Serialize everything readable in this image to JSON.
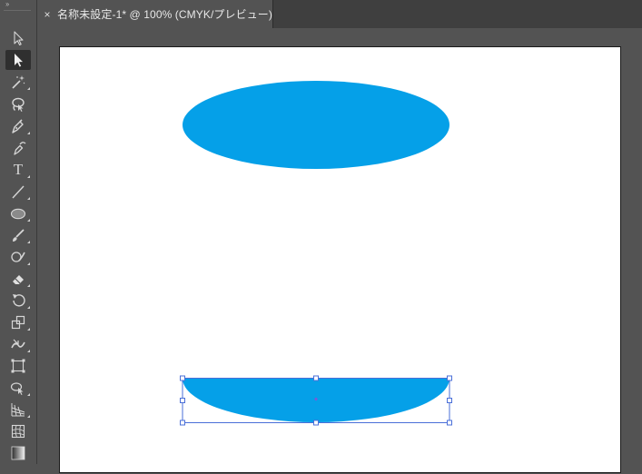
{
  "tab": {
    "close_glyph": "×",
    "title": "名称未設定-1* @ 100% (CMYK/プレビュー)"
  },
  "toolbar": {
    "grip_glyph": "››",
    "tools": [
      {
        "name": "selection-tool",
        "icon": "arrow-outline-icon",
        "active": false
      },
      {
        "name": "direct-selection-tool",
        "icon": "arrow-solid-icon",
        "active": true
      },
      {
        "name": "magic-wand-tool",
        "icon": "magic-wand-icon",
        "active": false
      },
      {
        "name": "lasso-tool",
        "icon": "lasso-icon",
        "active": false
      },
      {
        "name": "pen-tool",
        "icon": "pen-icon",
        "active": false
      },
      {
        "name": "curvature-tool",
        "icon": "curvature-pen-icon",
        "active": false
      },
      {
        "name": "type-tool",
        "icon": "type-icon",
        "label": "T",
        "active": false
      },
      {
        "name": "line-segment-tool",
        "icon": "line-icon",
        "active": false
      },
      {
        "name": "ellipse-tool",
        "icon": "ellipse-icon",
        "active": false
      },
      {
        "name": "paintbrush-tool",
        "icon": "brush-icon",
        "active": false
      },
      {
        "name": "shaper-tool",
        "icon": "shaper-icon",
        "active": false
      },
      {
        "name": "eraser-tool",
        "icon": "eraser-icon",
        "active": false
      },
      {
        "name": "rotate-tool",
        "icon": "rotate-icon",
        "active": false
      },
      {
        "name": "scale-tool",
        "icon": "scale-icon",
        "active": false
      },
      {
        "name": "width-tool",
        "icon": "width-icon",
        "active": false
      },
      {
        "name": "free-transform-tool",
        "icon": "free-transform-icon",
        "active": false
      },
      {
        "name": "shape-builder-tool",
        "icon": "shape-builder-icon",
        "active": false
      },
      {
        "name": "perspective-grid-tool",
        "icon": "perspective-grid-icon",
        "active": false
      },
      {
        "name": "mesh-tool",
        "icon": "mesh-icon",
        "active": false
      },
      {
        "name": "gradient-tool",
        "icon": "gradient-icon",
        "active": false
      }
    ]
  },
  "colors": {
    "fill": "#05A0E8",
    "selection": "#4a6fd8",
    "center_point": "#7a5ad8"
  },
  "canvas": {
    "zoom": "100%",
    "color_mode": "CMYK",
    "shapes": [
      {
        "name": "ellipse-shape",
        "kind": "ellipse"
      },
      {
        "name": "half-ellipse-shape",
        "kind": "half-ellipse",
        "selected": true
      }
    ]
  }
}
